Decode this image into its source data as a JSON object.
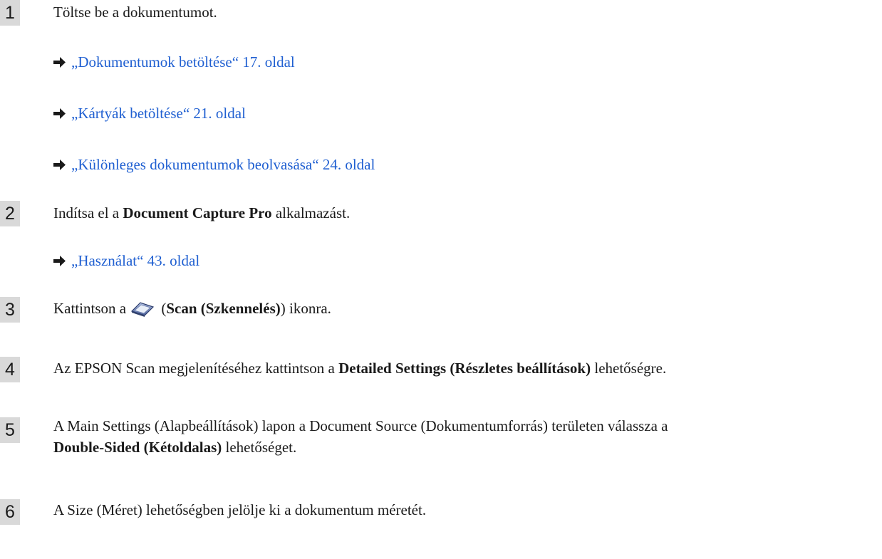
{
  "steps": [
    {
      "num": "1",
      "text": "Töltse be a dokumentumot."
    },
    {
      "num": "2",
      "pre": "Indítsa el a ",
      "bold": "Document Capture Pro",
      "post": " alkalmazást."
    },
    {
      "num": "3",
      "pre": "Kattintson a",
      "paren_open": " (",
      "bold": "Scan (Szkennelés)",
      "post": ") ikonra."
    },
    {
      "num": "4",
      "pre": "Az EPSON Scan megjelenítéséhez kattintson a ",
      "bold": "Detailed Settings (Részletes beállítások)",
      "post": " lehetőségre."
    },
    {
      "num": "5",
      "line1": "A Main Settings (Alapbeállítások) lapon a Document Source (Dokumentumforrás) területen válassza a",
      "bold": "Double-Sided (Kétoldalas)",
      "post": " lehetőséget."
    },
    {
      "num": "6",
      "text": "A Size (Méret) lehetőségben jelölje ki a dokumentum méretét."
    }
  ],
  "links": [
    {
      "label": "„Dokumentumok betöltése“ 17. oldal"
    },
    {
      "label": "„Kártyák betöltése“ 21. oldal"
    },
    {
      "label": "„Különleges dokumentumok beolvasása“ 24. oldal"
    },
    {
      "label": "„Használat“ 43. oldal"
    }
  ],
  "icons": {
    "arrow": "right-arrow-icon",
    "scan": "scanner-icon"
  },
  "colors": {
    "link": "#1f5fd1",
    "badge": "#d9d9d9"
  }
}
